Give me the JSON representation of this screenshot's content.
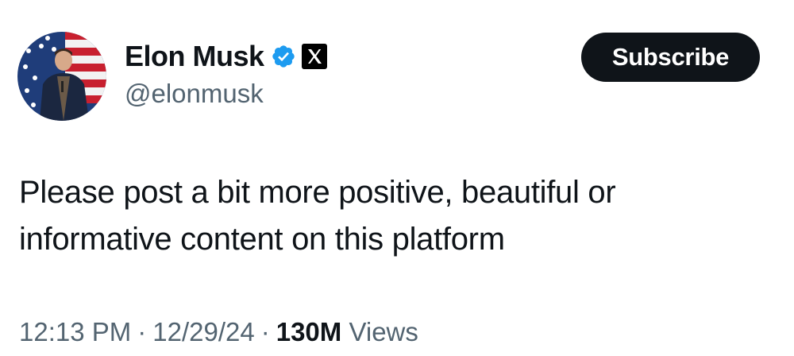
{
  "author": {
    "display_name": "Elon Musk",
    "handle": "@elonmusk",
    "verified_icon": "verified-badge-icon",
    "affiliate_icon": "x-logo-icon"
  },
  "actions": {
    "subscribe_label": "Subscribe"
  },
  "post": {
    "lines": [
      "Please post a bit more positive, beautiful or",
      "informative content on this platform"
    ]
  },
  "meta": {
    "time": "12:13 PM",
    "date": "12/29/24",
    "separator": "·",
    "views_count": "130M",
    "views_label": "Views"
  },
  "colors": {
    "text_primary": "#0f1419",
    "text_secondary": "#536471",
    "verified_blue": "#1d9bf0",
    "button_bg": "#0f1419"
  }
}
